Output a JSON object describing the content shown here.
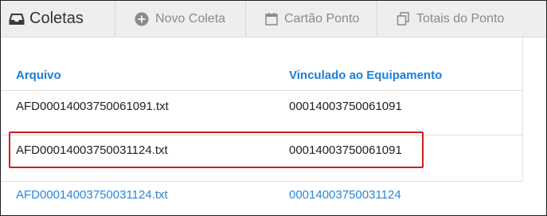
{
  "brand": {
    "title": "Coletas",
    "icon": "inbox-icon"
  },
  "nav": [
    {
      "label": "Novo Coleta",
      "icon": "plus-circle-icon"
    },
    {
      "label": "Cartão Ponto",
      "icon": "calendar-icon"
    },
    {
      "label": "Totais do Ponto",
      "icon": "copy-icon"
    }
  ],
  "table": {
    "headers": [
      "Arquivo",
      "Vinculado ao Equipamento"
    ],
    "rows": [
      {
        "arquivo": "AFD00014003750061091.txt",
        "equipamento": "00014003750061091"
      },
      {
        "arquivo": "AFD00014003750031124.txt",
        "equipamento": "00014003750061091"
      },
      {
        "arquivo": "AFD00014003750031124.txt",
        "equipamento": "00014003750031124"
      }
    ]
  },
  "colors": {
    "header_link": "#1a7fd6",
    "row_link": "#2a86d8",
    "highlight": "#d01c1c"
  }
}
